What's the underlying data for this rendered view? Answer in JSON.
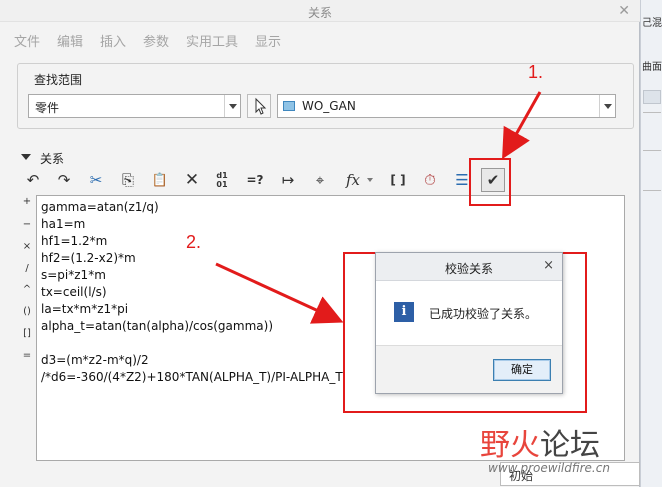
{
  "window": {
    "title": "关系"
  },
  "background_window": {
    "text_1": "己混合",
    "text_2": "曲面"
  },
  "menu": [
    "文件",
    "编辑",
    "插入",
    "参数",
    "实用工具",
    "显示"
  ],
  "find_scope": {
    "label": "查找范围",
    "type_value": "零件",
    "object_value": "WO_GAN"
  },
  "relations": {
    "label": "关系",
    "toolbar": {
      "undo": "↶",
      "redo": "↷",
      "cut": "✂",
      "copy": "⎘",
      "paste": "📋",
      "delete": "✕",
      "units": "d1 01",
      "evaluate": "=?",
      "dimension": "↦",
      "locate": "⌖",
      "function": "fx",
      "brackets": "[ ]",
      "calc": "⏱",
      "sort": "☰",
      "verify": "✔"
    },
    "operators": [
      "+",
      "−",
      "×",
      "/",
      "^",
      "()",
      "[]",
      "="
    ],
    "lines": [
      "gamma=atan(z1/q)",
      "ha1=m",
      "hf1=1.2*m",
      "hf2=(1.2-x2)*m",
      "s=pi*z1*m",
      "tx=ceil(l/s)",
      "la=tx*m*z1*pi",
      "alpha_t=atan(tan(alpha)/cos(gamma))",
      "",
      "d3=(m*z2-m*q)/2",
      "/*d6=-360/(4*Z2)+180*TAN(ALPHA_T)/PI-ALPHA_T"
    ]
  },
  "bottom": {
    "mode": "初始"
  },
  "annotations": {
    "step1": "1.",
    "step2": "2.",
    "color": "#e21b1b"
  },
  "message_box": {
    "title": "校验关系",
    "close": "×",
    "icon": "i",
    "message": "已成功校验了关系。",
    "ok": "确定"
  },
  "watermark": {
    "part1": "野火",
    "part2": "论坛",
    "url": "www.proewildfire.cn"
  }
}
